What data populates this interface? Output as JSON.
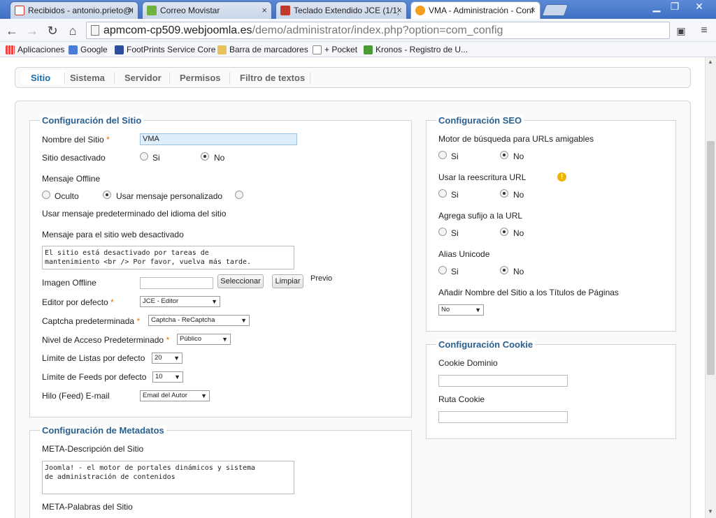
{
  "browser": {
    "tabs": [
      {
        "label": "Recibidos - antonio.prieto@t",
        "icon": "gmail-icon",
        "color": "#d93025"
      },
      {
        "label": "Correo Movistar",
        "icon": "movistar-icon",
        "color": "#6fb33f"
      },
      {
        "label": "Teclado Extendido JCE (1/1)",
        "icon": "jce-icon",
        "color": "#c23a2b"
      },
      {
        "label": "VMA - Administración - Confi",
        "icon": "joomla-icon",
        "color": "#f49e1e"
      }
    ],
    "close_glyph": "×",
    "url_host": "apmcom-cp509.webjoomla.es",
    "url_path": "/demo/administrator/index.php?option=com_config",
    "bookmarks": [
      "Aplicaciones",
      "Google",
      "FootPrints Service Core",
      "Barra de marcadores",
      "+ Pocket",
      "Kronos - Registro de U..."
    ]
  },
  "subnav": {
    "tabs": [
      "Sitio",
      "Sistema",
      "Servidor",
      "Permisos",
      "Filtro de textos"
    ]
  },
  "site": {
    "legend": "Configuración del Sitio",
    "site_name_label": "Nombre del Sitio",
    "site_name_value": "VMA",
    "required_mark": "*",
    "offline_label": "Sitio desactivado",
    "yes": "Si",
    "no": "No",
    "offline_msg_label": "Mensaje Offline",
    "offline_msg_opt1": "Oculto",
    "offline_msg_opt2": "Usar mensaje personalizado",
    "offline_msg_opt3": "Usar mensaje predeterminado del idioma del sitio",
    "offline_text_label": "Mensaje para el sitio web desactivado",
    "offline_text_value": "El sitio está desactivado por tareas de\nmantenimiento <br /> Por favor, vuelva más tarde.",
    "offline_image_label": "Imagen Offline",
    "select_btn": "Seleccionar",
    "clear_btn": "Limpiar",
    "preview": "Previo",
    "editor_label": "Editor por defecto",
    "editor_value": "JCE - Editor",
    "captcha_label": "Captcha predeterminada",
    "captcha_value": "Captcha - ReCaptcha",
    "access_label": "Nivel de Acceso Predeterminado",
    "access_value": "Público",
    "list_limit_label": "Límite de Listas por defecto",
    "list_limit_value": "20",
    "feed_limit_label": "Límite de Feeds por defecto",
    "feed_limit_value": "10",
    "feed_email_label": "Hilo (Feed) E-mail",
    "feed_email_value": "Email del Autor"
  },
  "meta": {
    "legend": "Configuración de Metadatos",
    "desc_label": "META-Descripción del Sitio",
    "desc_value": "Joomla! - el motor de portales dinámicos y sistema\nde administración de contenidos",
    "keywords_label": "META-Palabras del Sitio"
  },
  "seo": {
    "legend": "Configuración SEO",
    "sef_label": "Motor de búsqueda para URLs amigables",
    "rewrite_label": "Usar la reescritura URL",
    "suffix_label": "Agrega sufijo a la URL",
    "unicode_label": "Alias Unicode",
    "sitename_label": "Añadir Nombre del Sitio a los Títulos de Páginas",
    "sitename_value": "No",
    "warn_glyph": "!"
  },
  "cookie": {
    "legend": "Configuración Cookie",
    "domain_label": "Cookie Dominio",
    "path_label": "Ruta Cookie"
  },
  "glyphs": {
    "arrow": "▼"
  }
}
